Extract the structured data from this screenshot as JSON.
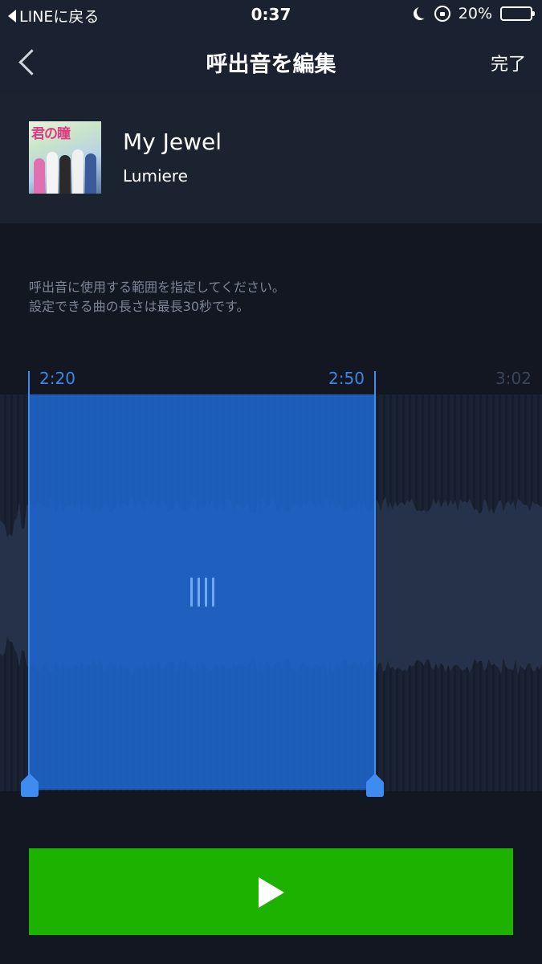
{
  "status_bar": {
    "back_label": "LINEに戻る",
    "time": "0:37",
    "battery": "20%",
    "battery_level": 0.2
  },
  "nav": {
    "title": "呼出音を編集",
    "done_label": "完了"
  },
  "song": {
    "album_art_text": "君の瞳",
    "title": "My Jewel",
    "artist": "Lumiere"
  },
  "instructions": [
    "呼出音に使用する範囲を指定してください。",
    "設定できる曲の長さは最長30秒です。"
  ],
  "editor": {
    "start_time": "2:20",
    "end_time": "2:50",
    "total_time": "3:02"
  },
  "colors": {
    "selection": "#1e69d2",
    "accent": "#3f8cf0",
    "play": "#1db100"
  }
}
